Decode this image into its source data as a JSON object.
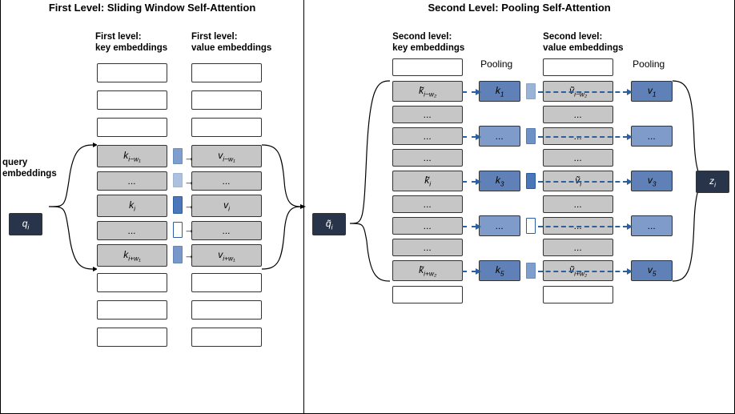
{
  "left": {
    "title": "First Level: Sliding Window Self-Attention",
    "queryLabel": "query\nembeddings",
    "queryBox": "qᵢ",
    "col1Header": "First level:\nkey embeddings",
    "col2Header": "First level:\nvalue embeddings",
    "keyLabels": [
      "",
      "",
      "",
      "k_{i-w₁}",
      "...",
      "kᵢ",
      "...",
      "k_{i+w₁}",
      "",
      "",
      ""
    ],
    "valLabels": [
      "",
      "",
      "",
      "v_{i-w₁}",
      "...",
      "vᵢ",
      "...",
      "v_{i+w₁}",
      "",
      "",
      ""
    ],
    "output": "q̃ᵢ"
  },
  "right": {
    "title": "Second Level: Pooling Self-Attention",
    "col1Header": "Second level:\nkey embeddings",
    "col2Header": "Second level:\nvalue embeddings",
    "pooling": "Pooling",
    "khat": [
      "",
      "k̃_{i-w₂}",
      "...",
      "...",
      "...",
      "k̃ᵢ",
      "...",
      "...",
      "...",
      "k̃_{i+w₂}",
      ""
    ],
    "vhat": [
      "",
      "ṽ_{i-w₂}",
      "...",
      "...",
      "...",
      "ṽᵢ",
      "...",
      "...",
      "...",
      "ṽ_{i+w₂}",
      ""
    ],
    "kpool": [
      "k₁",
      "...",
      "k₃",
      "...",
      "k₅"
    ],
    "vpool": [
      "v₁",
      "...",
      "v₃",
      "...",
      "v₅"
    ],
    "output": "zᵢ"
  }
}
